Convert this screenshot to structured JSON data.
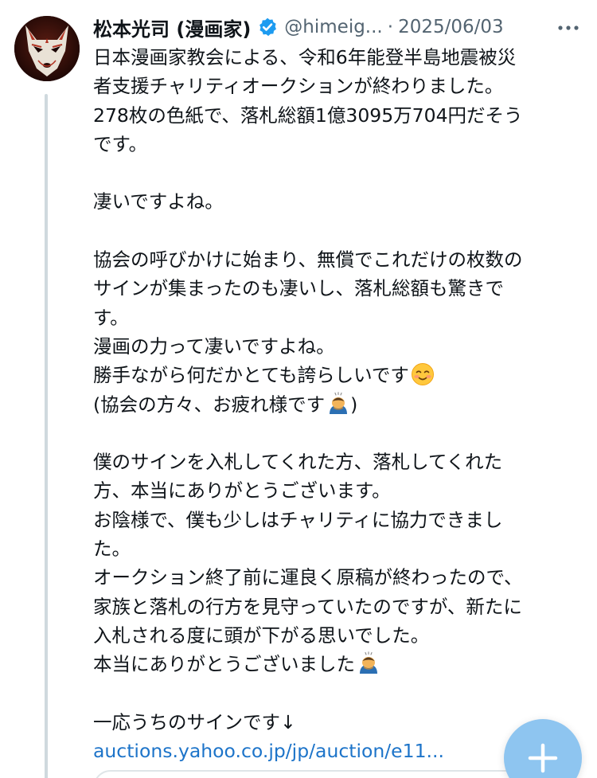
{
  "tweet": {
    "display_name": "松本光司 (漫画家)",
    "handle": "@himeig...",
    "separator": "·",
    "date": "2025/06/03",
    "lines": [
      "日本漫画家教会による、令和6年能登半島地震被災",
      "者支援チャリティオークションが終わりました。",
      "278枚の色紙で、落札総額1億3095万704円だそう",
      "です。",
      "",
      "凄いですよね。",
      "",
      "協会の呼びかけに始まり、無償でこれだけの枚数の",
      "サインが集まったのも凄いし、落札総額も驚きで",
      "す。",
      "漫画の力って凄いですよね。",
      "勝手ながら何だかとても誇らしいです",
      "(協会の方々、お疲れ様です",
      "",
      "僕のサインを入札してくれた方、落札してくれた",
      "方、本当にありがとうございます。",
      "お陰様で、僕も少しはチャリティに協力できまし",
      "た。",
      "オークション終了前に運良く原稿が終わったので、",
      "家族と落札の行方を見守っていたのですが、新たに",
      "入札される度に頭が下がる思いでした。",
      "本当にありがとうございました",
      "",
      "一応うちのサインです↓"
    ],
    "closing_paren": ")",
    "link_text": "auctions.yahoo.co.jp/jp/auction/e11..."
  },
  "icons": {
    "verified": "verified-badge-icon",
    "more": "more-horizontal-icon",
    "smile": "smiling-face-emoji",
    "bow": "bowing-person-emoji",
    "compose": "plus-icon"
  },
  "colors": {
    "text": "#0f1419",
    "secondary": "#536471",
    "link": "#1d74c9",
    "verified": "#1d9bf0",
    "fab": "#8ec5f0",
    "thread_line": "#cfd9de"
  }
}
